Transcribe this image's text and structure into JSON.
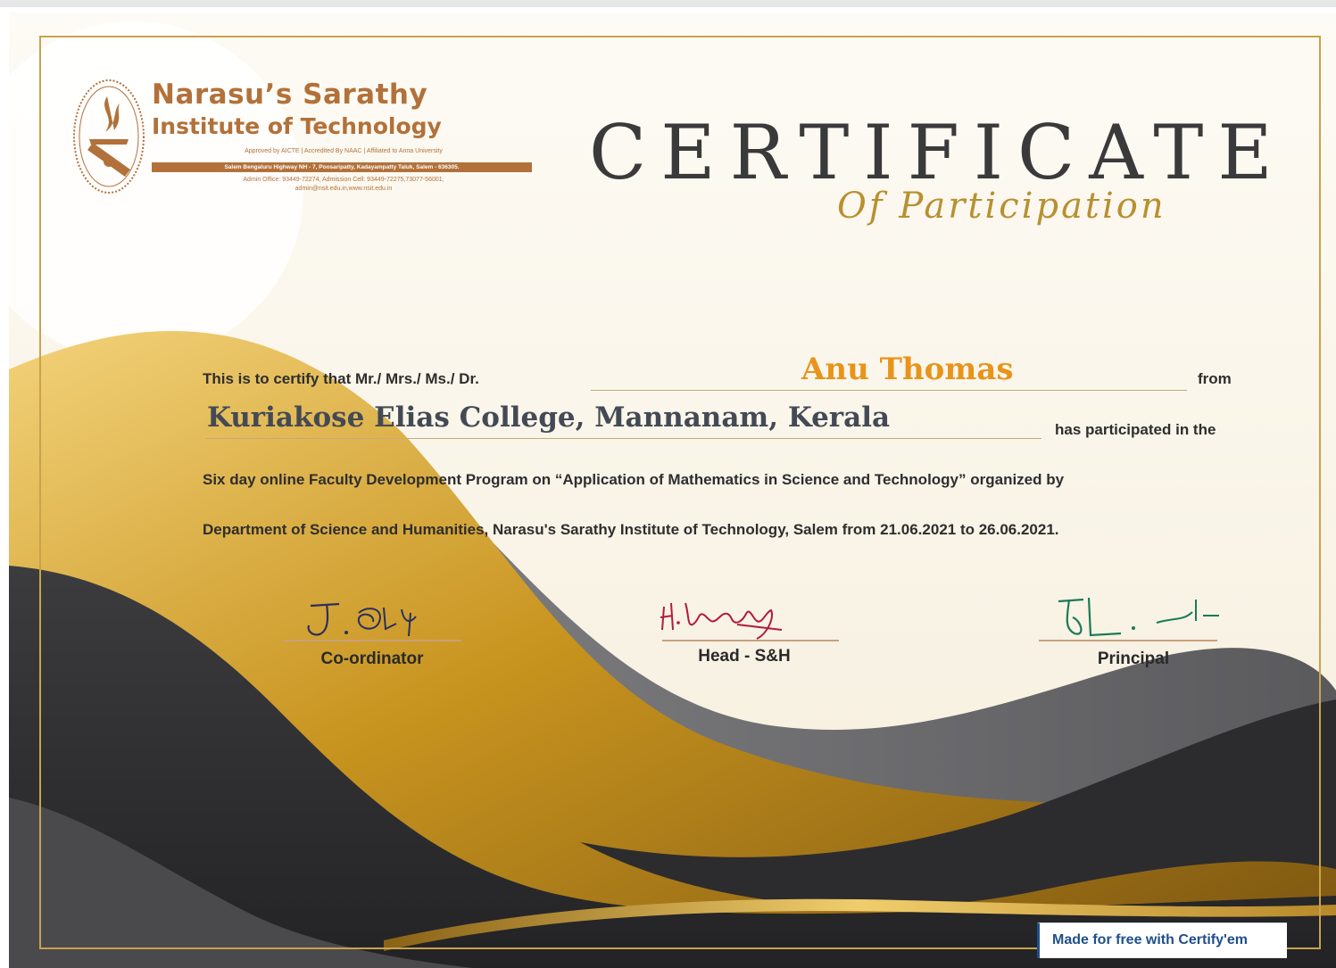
{
  "logo": {
    "title": "Narasu’s Sarathy",
    "subtitle": "Institute of Technology",
    "approval": "Approved by AICTE | Accredited By NAAC | Affiliated to Anna University",
    "address": "Salem Bengaluru Highway NH - 7, Poosaripatty, Kadayampatty Taluk, Salem - 636305.",
    "contact": "Admin Office: 93449-72274, Admission Cell: 93449-72275,73077-56001,",
    "web": "admin@nsit.edu.in,www.nsit.edu.in"
  },
  "heading": {
    "title": "CERTIFICATE",
    "subtitle": "Of Participation"
  },
  "body": {
    "certify_prefix": "This is to certify that Mr./ Mrs./ Ms./ Dr.",
    "recipient_name": "Anu Thomas",
    "from_word": "from",
    "institution": "Kuriakose Elias College, Mannanam, Kerala",
    "participated": "has participated in the",
    "line3": "Six day online Faculty Development Program on “Application of Mathematics in Science and Technology” organized by",
    "line4": "Department of Science and Humanities, Narasu's Sarathy Institute of Technology, Salem from 21.06.2021 to 26.06.2021."
  },
  "signatures": [
    {
      "role": "Co-ordinator",
      "ink": "#2b2f5e"
    },
    {
      "role": "Head - S&H",
      "ink": "#b21a3c"
    },
    {
      "role": "Principal",
      "ink": "#1b7a55"
    }
  ],
  "badge": {
    "text": "Made for free with Certify'em"
  },
  "colors": {
    "gold": "#c9a24c",
    "name_orange": "#e8941a",
    "dark_wave": "#3b3b3d",
    "brand_brown": "#b2713a"
  }
}
